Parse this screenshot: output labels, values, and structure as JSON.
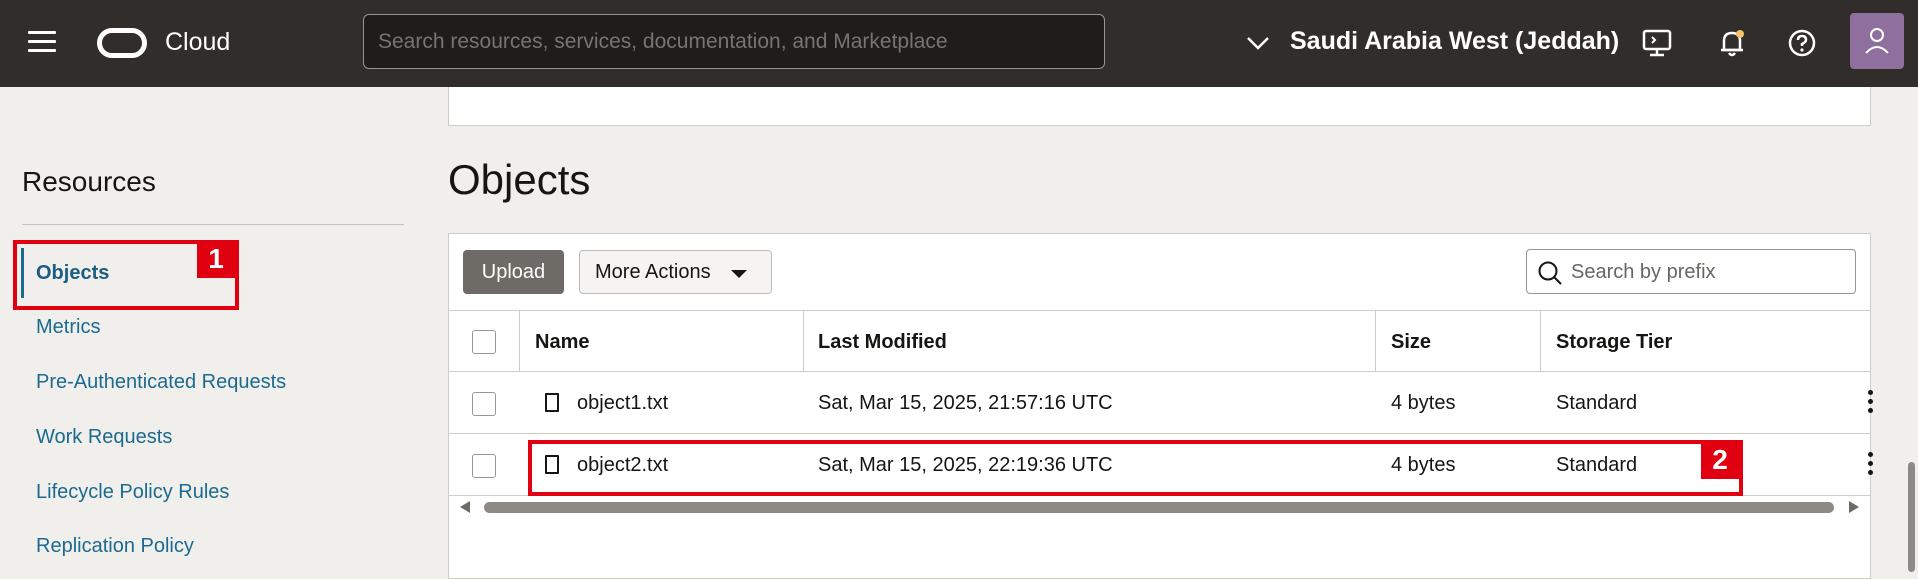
{
  "header": {
    "brand": "Cloud",
    "search_placeholder": "Search resources, services, documentation, and Marketplace",
    "region": "Saudi Arabia West (Jeddah)",
    "icons": [
      "menu-icon",
      "oracle-logo",
      "chevron-down-icon",
      "cloud-shell-icon",
      "bell-icon",
      "help-icon",
      "user-avatar"
    ]
  },
  "sidebar": {
    "title": "Resources",
    "items": [
      {
        "label": "Objects",
        "active": true
      },
      {
        "label": "Metrics"
      },
      {
        "label": "Pre-Authenticated Requests"
      },
      {
        "label": "Work Requests"
      },
      {
        "label": "Lifecycle Policy Rules"
      },
      {
        "label": "Replication Policy"
      }
    ]
  },
  "main": {
    "title": "Objects",
    "upload_label": "Upload",
    "more_actions_label": "More Actions",
    "search_placeholder": "Search by prefix",
    "columns": [
      "Name",
      "Last Modified",
      "Size",
      "Storage Tier"
    ],
    "rows": [
      {
        "name": "object1.txt",
        "modified": "Sat, Mar 15, 2025, 21:57:16 UTC",
        "size": "4 bytes",
        "tier": "Standard"
      },
      {
        "name": "object2.txt",
        "modified": "Sat, Mar 15, 2025, 22:19:36 UTC",
        "size": "4 bytes",
        "tier": "Standard"
      }
    ]
  },
  "annotations": {
    "callout_1": "1",
    "callout_2": "2"
  },
  "colors": {
    "header_bg": "#312d2a",
    "link": "#1b6a8f",
    "callout": "#e00010",
    "page_bg": "#f1efec"
  }
}
